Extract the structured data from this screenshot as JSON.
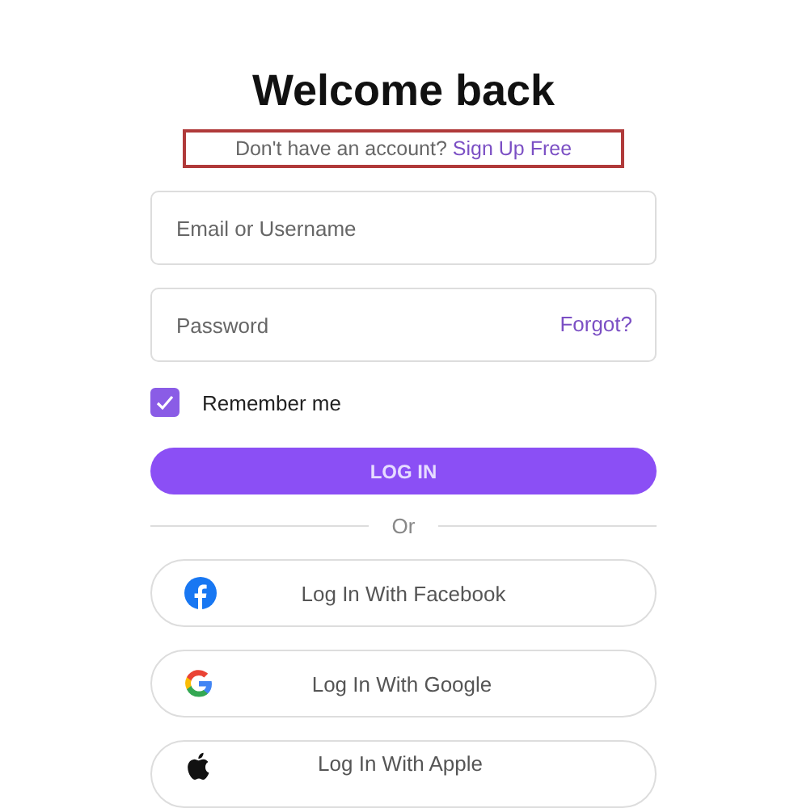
{
  "title": "Welcome back",
  "signup": {
    "prompt": "Don't have an account?",
    "link": "Sign Up Free",
    "highlighted": true
  },
  "fields": [
    {
      "placeholder": "Email or Username"
    },
    {
      "placeholder": "Password",
      "action": "Forgot?"
    }
  ],
  "remember": {
    "label": "Remember me",
    "checked": true
  },
  "login_button": "LOG IN",
  "divider": "Or",
  "social_buttons": [
    {
      "kind": "facebook",
      "label": "Log In With Facebook"
    },
    {
      "kind": "google",
      "label": "Log In With Google"
    },
    {
      "kind": "apple",
      "label": "Log In With Apple"
    }
  ]
}
